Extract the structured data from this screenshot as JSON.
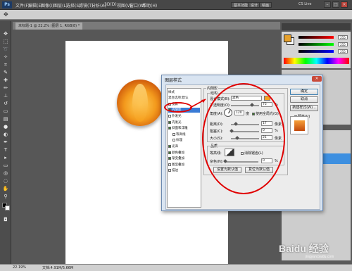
{
  "app": {
    "logo": "Ps",
    "menus": [
      "文件(F)",
      "编辑(E)",
      "图像(I)",
      "图层(L)",
      "选择(S)",
      "滤镜(T)",
      "分析(A)",
      "3D(D)",
      "视图(V)",
      "窗口(W)",
      "帮助(H)"
    ],
    "workspace_buttons": [
      "基本功能",
      "设计",
      "绘画"
    ],
    "cs_live": "CS Live"
  },
  "document": {
    "tab_label": "未标题-1 @ 22.2% (图层 1, RGB/8) *",
    "zoom": "22.19%",
    "status": "文档:4.91M/5.66M"
  },
  "dialog": {
    "title": "图层样式",
    "style_list": [
      {
        "label": "样式",
        "checked": false,
        "has_checkbox": false,
        "selected": false
      },
      {
        "label": "混合选项:默认",
        "checked": false,
        "has_checkbox": false,
        "selected": false
      },
      {
        "label": "投影",
        "checked": false,
        "has_checkbox": true,
        "selected": false
      },
      {
        "label": "内阴影",
        "checked": true,
        "has_checkbox": true,
        "selected": true
      },
      {
        "label": "外发光",
        "checked": false,
        "has_checkbox": true,
        "selected": false
      },
      {
        "label": "内发光",
        "checked": true,
        "has_checkbox": true,
        "selected": false
      },
      {
        "label": "斜面和浮雕",
        "checked": true,
        "has_checkbox": true,
        "selected": false
      },
      {
        "label": "等高线",
        "checked": false,
        "has_checkbox": true,
        "selected": false
      },
      {
        "label": "纹理",
        "checked": false,
        "has_checkbox": true,
        "selected": false
      },
      {
        "label": "光泽",
        "checked": true,
        "has_checkbox": true,
        "selected": false
      },
      {
        "label": "颜色叠加",
        "checked": true,
        "has_checkbox": true,
        "selected": false
      },
      {
        "label": "渐变叠加",
        "checked": true,
        "has_checkbox": true,
        "selected": false
      },
      {
        "label": "图案叠加",
        "checked": false,
        "has_checkbox": true,
        "selected": false
      },
      {
        "label": "描边",
        "checked": false,
        "has_checkbox": true,
        "selected": false
      }
    ],
    "section_title": "内阴影",
    "structure_title": "结构",
    "blend_mode_label": "混合模式(B):",
    "blend_mode_value": "滤色",
    "blend_color": "#f5a020",
    "opacity_label": "不透明度(O):",
    "opacity_value": "75",
    "opacity_unit": "%",
    "angle_label": "角度(A):",
    "angle_value": "120",
    "angle_unit": "度",
    "global_light_label": "使用全局光(G)",
    "distance_label": "距离(D):",
    "distance_value": "17",
    "distance_unit": "像素",
    "choke_label": "阻塞(C):",
    "choke_value": "0",
    "choke_unit": "%",
    "size_label": "大小(S):",
    "size_value": "21",
    "size_unit": "像素",
    "quality_title": "品质",
    "contour_label": "等高线:",
    "antialias_label": "消除锯齿(L)",
    "noise_label": "杂色(N):",
    "noise_value": "0",
    "noise_unit": "%",
    "default_button": "设置为默认值",
    "reset_button": "复位为默认值",
    "ok_button": "确定",
    "cancel_button": "取消",
    "new_style_button": "新建样式(W)...",
    "preview_label": "预览(V)"
  },
  "colors": {
    "foreground": "#e8a22c",
    "background": "#ffffff",
    "annotation": "#e00000",
    "selection": "#3a7bd5"
  },
  "color_panel": {
    "r_value": "255",
    "g_value": "255",
    "b_value": "255"
  },
  "watermark": {
    "brand": "Baidu 经验",
    "sub": "jingyan.baidu.com"
  }
}
